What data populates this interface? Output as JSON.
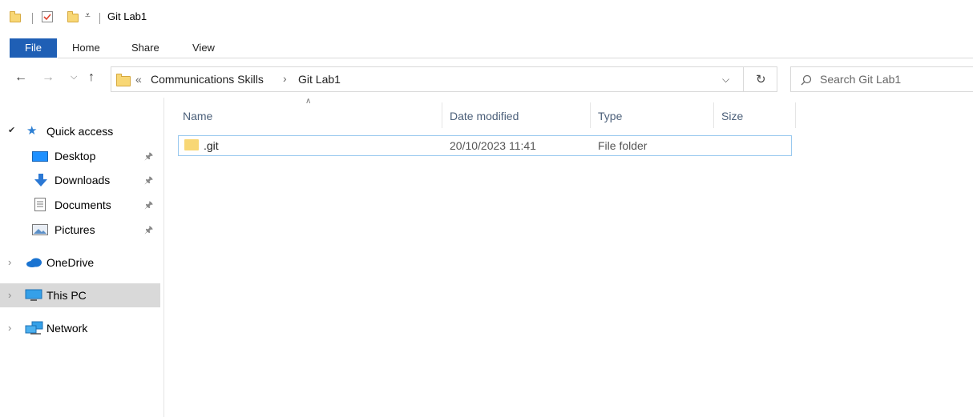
{
  "window": {
    "title": "Git Lab1"
  },
  "ribbon": {
    "tabs": [
      {
        "label": "File",
        "active": true
      },
      {
        "label": "Home"
      },
      {
        "label": "Share"
      },
      {
        "label": "View"
      }
    ]
  },
  "address": {
    "overflow": "«",
    "crumbs": [
      "Communications Skills",
      "Git Lab1"
    ],
    "separator": "›"
  },
  "search": {
    "placeholder": "Search Git Lab1"
  },
  "sidebar": {
    "quick_access": "Quick access",
    "items": [
      {
        "label": "Desktop",
        "icon": "desktop-icon",
        "pinned": true
      },
      {
        "label": "Downloads",
        "icon": "downloads-icon",
        "pinned": true
      },
      {
        "label": "Documents",
        "icon": "documents-icon",
        "pinned": true
      },
      {
        "label": "Pictures",
        "icon": "pictures-icon",
        "pinned": true
      }
    ],
    "onedrive": "OneDrive",
    "this_pc": "This PC",
    "network": "Network"
  },
  "columns": {
    "name": "Name",
    "date": "Date modified",
    "type": "Type",
    "size": "Size"
  },
  "files": [
    {
      "name": ".git",
      "date": "20/10/2023 11:41",
      "type": "File folder",
      "size": ""
    }
  ],
  "colors": {
    "file_tab": "#1f5fb5",
    "selection_border": "#99c9ef",
    "selected_nav": "#d9d9d9",
    "column_header_text": "#4c607a"
  }
}
